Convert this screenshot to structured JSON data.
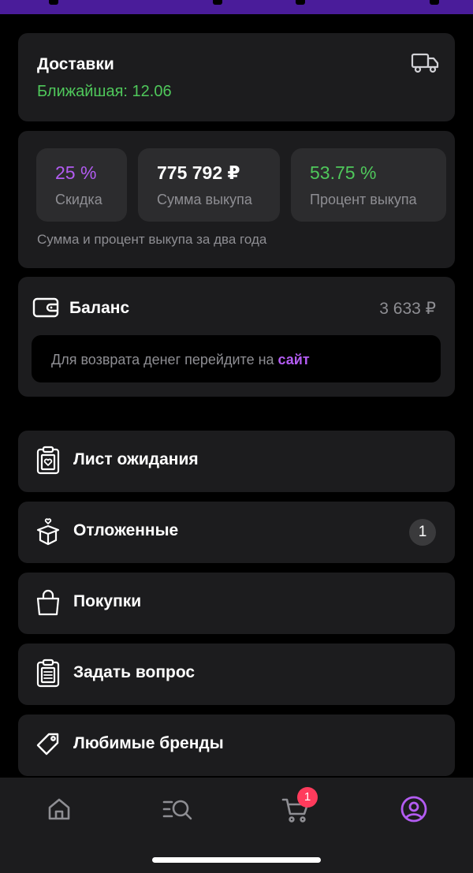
{
  "deliveries": {
    "title": "Доставки",
    "nearest": "Ближайшая: 12.06",
    "icon": "truck-icon"
  },
  "stats": {
    "items": [
      {
        "value": "25 %",
        "label": "Скидка"
      },
      {
        "value": "775 792 ₽",
        "label": "Сумма выкупа"
      },
      {
        "value": "53.75 %",
        "label": "Процент выкупа"
      }
    ],
    "note": "Сумма и процент выкупа за два года"
  },
  "balance": {
    "title": "Баланс",
    "amount": "3 633 ₽",
    "info_text": "Для возврата денег перейдите на ",
    "info_link": "сайт",
    "icon": "wallet-icon"
  },
  "menu": [
    {
      "label": "Лист ожидания",
      "icon": "waitlist-icon"
    },
    {
      "label": "Отложенные",
      "icon": "gift-box-icon",
      "badge": "1"
    },
    {
      "label": "Покупки",
      "icon": "shopping-bag-icon"
    },
    {
      "label": "Задать вопрос",
      "icon": "clipboard-icon"
    },
    {
      "label": "Любимые бренды",
      "icon": "tag-icon"
    }
  ],
  "tabbar": {
    "cart_badge": "1",
    "tabs": [
      "home-icon",
      "catalog-search-icon",
      "cart-icon",
      "profile-icon"
    ],
    "active": "profile-icon"
  },
  "colors": {
    "accent": "#b35cf2",
    "green": "#4fc85b",
    "badge_red": "#ff3b5c",
    "card_bg": "#1c1c1e"
  }
}
